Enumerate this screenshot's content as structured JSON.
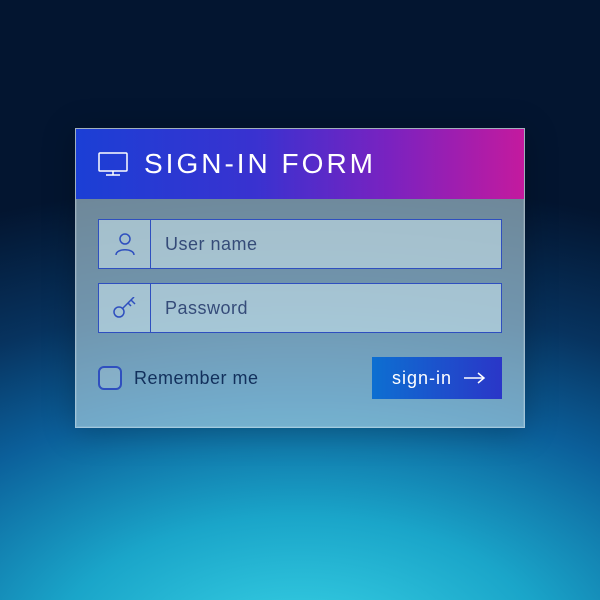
{
  "header": {
    "title": "SIGN-IN FORM",
    "icon": "monitor-icon"
  },
  "fields": {
    "username": {
      "placeholder": "User name",
      "value": ""
    },
    "password": {
      "placeholder": "Password",
      "value": ""
    }
  },
  "remember": {
    "label": "Remember me",
    "checked": false
  },
  "submit": {
    "label": "sign-in"
  },
  "colors": {
    "header_gradient_from": "#1b3fd5",
    "header_gradient_to": "#c41a9e",
    "field_border": "#2f4fbf",
    "button_from": "#0d6fd1",
    "button_to": "#2a36c8"
  }
}
